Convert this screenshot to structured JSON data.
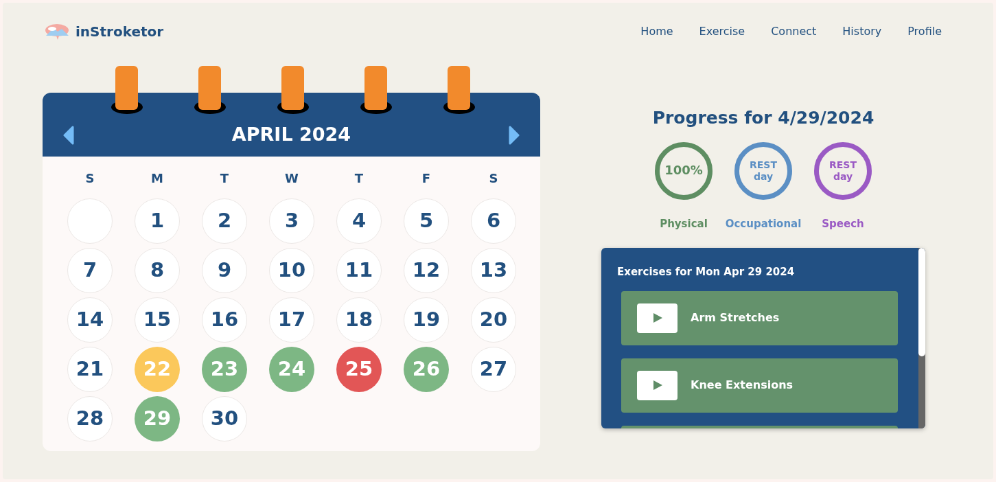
{
  "brand": "inStroketor",
  "nav": [
    {
      "label": "Home"
    },
    {
      "label": "Exercise"
    },
    {
      "label": "Connect"
    },
    {
      "label": "History"
    },
    {
      "label": "Profile"
    }
  ],
  "calendar": {
    "title": "APRIL 2024",
    "weekdays": [
      "S",
      "M",
      "T",
      "W",
      "T",
      "F",
      "S"
    ],
    "weeks": [
      [
        {
          "kind": "empty"
        },
        {
          "kind": "day",
          "day": "1"
        },
        {
          "kind": "day",
          "day": "2"
        },
        {
          "kind": "day",
          "day": "3"
        },
        {
          "kind": "day",
          "day": "4"
        },
        {
          "kind": "day",
          "day": "5"
        },
        {
          "kind": "day",
          "day": "6"
        }
      ],
      [
        {
          "kind": "day",
          "day": "7"
        },
        {
          "kind": "day",
          "day": "8"
        },
        {
          "kind": "day",
          "day": "9"
        },
        {
          "kind": "day",
          "day": "10"
        },
        {
          "kind": "day",
          "day": "11"
        },
        {
          "kind": "day",
          "day": "12"
        },
        {
          "kind": "day",
          "day": "13"
        }
      ],
      [
        {
          "kind": "day",
          "day": "14"
        },
        {
          "kind": "day",
          "day": "15"
        },
        {
          "kind": "day",
          "day": "16"
        },
        {
          "kind": "day",
          "day": "17"
        },
        {
          "kind": "day",
          "day": "18"
        },
        {
          "kind": "day",
          "day": "19"
        },
        {
          "kind": "day",
          "day": "20"
        }
      ],
      [
        {
          "kind": "day",
          "day": "21"
        },
        {
          "kind": "day",
          "day": "22",
          "color": "#fbc85b"
        },
        {
          "kind": "day",
          "day": "23",
          "color": "#7db784"
        },
        {
          "kind": "day",
          "day": "24",
          "color": "#7db784"
        },
        {
          "kind": "day",
          "day": "25",
          "color": "#e25656"
        },
        {
          "kind": "day",
          "day": "26",
          "color": "#7db784"
        },
        {
          "kind": "day",
          "day": "27"
        }
      ],
      [
        {
          "kind": "day",
          "day": "28"
        },
        {
          "kind": "day",
          "day": "29",
          "color": "#7db784"
        },
        {
          "kind": "day",
          "day": "30"
        }
      ]
    ]
  },
  "progress": {
    "title": "Progress for 4/29/2024",
    "rings": [
      {
        "value": "100%",
        "label": "Physical",
        "color": "#5e8e62"
      },
      {
        "value": "REST",
        "sub": "day",
        "label": "Occupational",
        "color": "#5b8fc4"
      },
      {
        "value": "REST",
        "sub": "day",
        "label": "Speech",
        "color": "#9a5ac4"
      }
    ]
  },
  "exercises": {
    "title": "Exercises for Mon Apr 29 2024",
    "items": [
      {
        "name": "Arm Stretches"
      },
      {
        "name": "Knee Extensions"
      }
    ]
  }
}
